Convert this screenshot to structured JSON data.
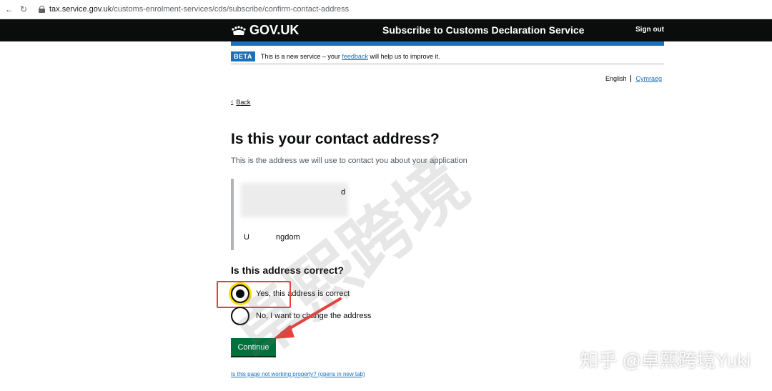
{
  "browser": {
    "url_host": "tax.service.gov.uk",
    "url_path": "/customs-enrolment-services/cds/subscribe/confirm-contact-address"
  },
  "header": {
    "logo": "GOV.UK",
    "service_name": "Subscribe to Customs Declaration Service",
    "sign_out": "Sign out"
  },
  "phase_banner": {
    "tag": "BETA",
    "text_before": "This is a new service – your",
    "link": "feedback",
    "text_after": "will help us to improve it."
  },
  "language": {
    "english": "English",
    "welsh": "Cymraeg"
  },
  "back_link": "Back",
  "page": {
    "title": "Is this your contact address?",
    "hint": "This is the address we will use to contact you about your application",
    "address_lines": [
      "d",
      "U",
      "ngdom"
    ],
    "question": "Is this address correct?",
    "options": [
      {
        "label": "Yes, this address is correct",
        "selected": true
      },
      {
        "label": "No, I want to change the address",
        "selected": false
      }
    ],
    "continue": "Continue",
    "help_link": "Is this page not working properly? (opens in new tab)"
  },
  "watermark": {
    "diagonal": "卓熙跨境",
    "brand": "知乎 @卓熙跨境Yuki"
  },
  "colors": {
    "gov_black": "#0b0c0c",
    "gov_blue": "#1d70b8",
    "button_green": "#00703c",
    "focus_yellow": "#ffdd00",
    "annotation_red": "#e8413c"
  }
}
